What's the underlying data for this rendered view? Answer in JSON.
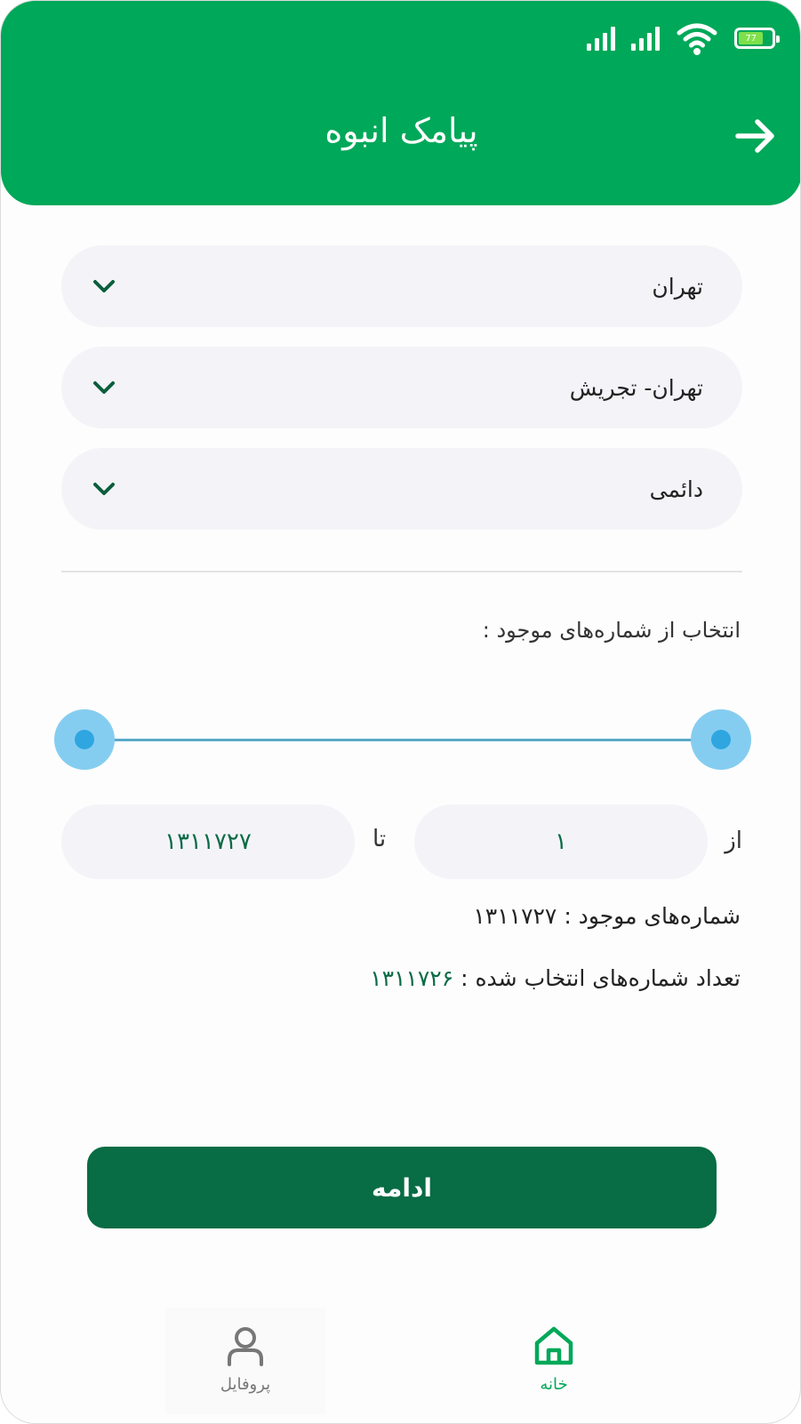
{
  "status_bar": {
    "battery_level": "77",
    "icons": [
      "signal-icon",
      "signal-icon",
      "wifi-icon",
      "battery-icon"
    ]
  },
  "header": {
    "title": "پیامک انبوه",
    "back_icon": "arrow-right-icon"
  },
  "selects": [
    {
      "value": "تهران",
      "icon": "chevron-down-icon"
    },
    {
      "value": "تهران- تجریش",
      "icon": "chevron-down-icon"
    },
    {
      "value": "دائمی",
      "icon": "chevron-down-icon"
    }
  ],
  "range": {
    "label": "انتخاب از شماره‌های موجود :",
    "from_label": "از",
    "to_label": "تا",
    "from_value": "۱",
    "to_value": "۱۳۱۱۷۲۷",
    "slider_min_fraction": 0,
    "slider_max_fraction": 1
  },
  "info": {
    "available_label": "شماره‌های موجود :",
    "available_value": "۱۳۱۱۷۲۷",
    "selected_label": "تعداد شماره‌های انتخاب شده :",
    "selected_value": "۱۳۱۱۷۲۶"
  },
  "actions": {
    "continue_label": "ادامه"
  },
  "bottom_nav": {
    "profile_label": "پروفایل",
    "home_label": "خانه"
  },
  "colors": {
    "header": "#00a859",
    "button": "#086c44",
    "slider_thumb": "#85cdf0",
    "accent_text": "#0b6b46"
  }
}
